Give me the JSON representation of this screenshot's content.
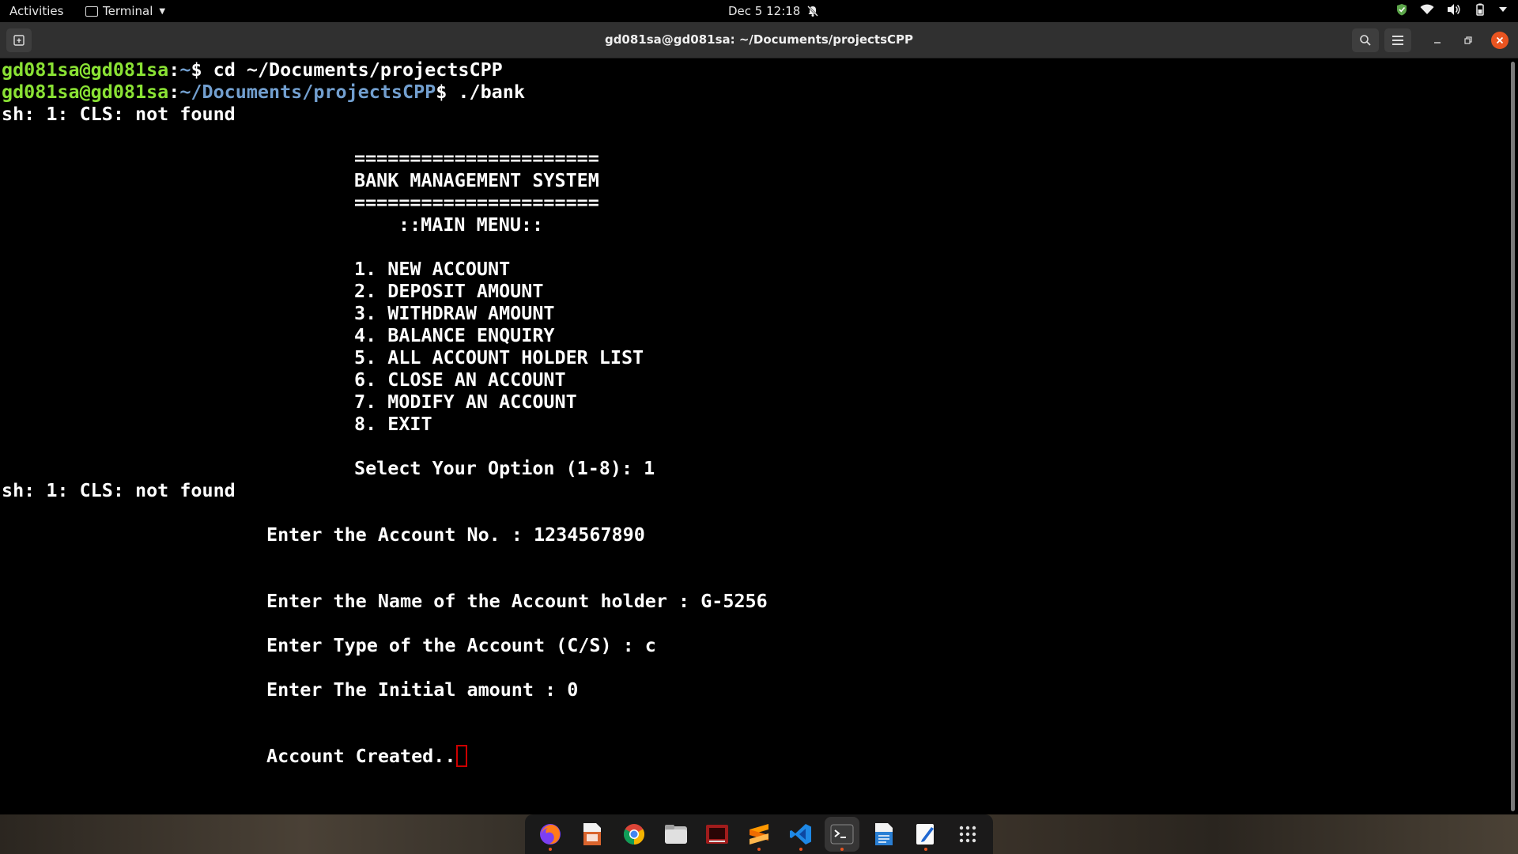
{
  "topbar": {
    "activities": "Activities",
    "app_name": "Terminal",
    "clock": "Dec 5  12:18"
  },
  "window": {
    "title": "gd081sa@gd081sa: ~/Documents/projectsCPP"
  },
  "terminal": {
    "line1": {
      "user": "gd081sa@gd081sa",
      "sep": ":",
      "path": "~",
      "prompt": "$ ",
      "cmd": "cd ~/Documents/projectsCPP"
    },
    "line2": {
      "user": "gd081sa@gd081sa",
      "sep": ":",
      "path": "~/Documents/projectsCPP",
      "prompt": "$ ",
      "cmd": "./bank"
    },
    "err1": "sh: 1: CLS: not found",
    "banner_rule_top": "======================",
    "banner_title": "BANK MANAGEMENT SYSTEM",
    "banner_rule_bottom": "======================",
    "menu_title": "::MAIN MENU::",
    "menu_items": [
      "1. NEW ACCOUNT",
      "2. DEPOSIT AMOUNT",
      "3. WITHDRAW AMOUNT",
      "4. BALANCE ENQUIRY",
      "5. ALL ACCOUNT HOLDER LIST",
      "6. CLOSE AN ACCOUNT",
      "7. MODIFY AN ACCOUNT",
      "8. EXIT"
    ],
    "select_prompt": "Select Your Option (1-8): 1",
    "err2": "sh: 1: CLS: not found",
    "acc_no": "Enter the Account No. : 1234567890",
    "acc_name": "Enter the Name of the Account holder : G-5256",
    "acc_type": "Enter Type of the Account (C/S) : c",
    "acc_amount": "Enter The Initial amount : 0",
    "acc_created": "Account Created.."
  },
  "dock": {
    "items": [
      {
        "icon": "firefox-icon",
        "active": false,
        "running": true
      },
      {
        "icon": "libreoffice-impress-icon",
        "active": false,
        "running": false
      },
      {
        "icon": "chrome-icon",
        "active": false,
        "running": false
      },
      {
        "icon": "files-icon",
        "active": false,
        "running": false
      },
      {
        "icon": "media-player-icon",
        "active": false,
        "running": false
      },
      {
        "icon": "sublime-text-icon",
        "active": false,
        "running": true
      },
      {
        "icon": "vscode-icon",
        "active": false,
        "running": true
      },
      {
        "icon": "terminal-icon",
        "active": true,
        "running": true
      },
      {
        "icon": "libreoffice-writer-icon",
        "active": false,
        "running": false
      },
      {
        "icon": "text-editor-icon",
        "active": false,
        "running": true
      },
      {
        "icon": "show-apps-icon",
        "active": false,
        "running": false
      }
    ]
  }
}
